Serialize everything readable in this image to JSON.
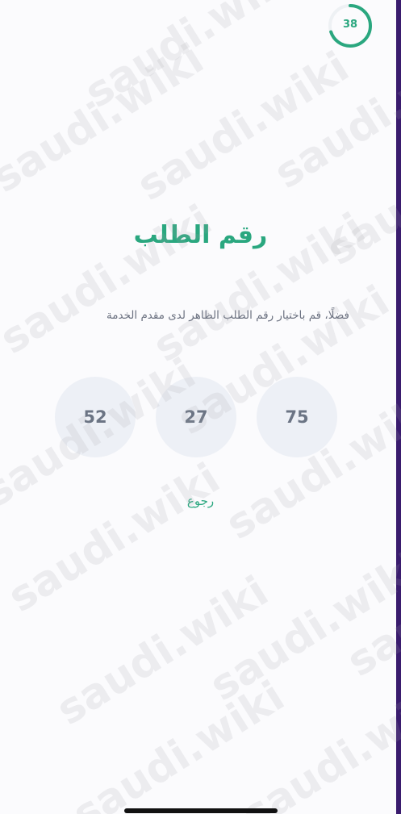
{
  "timer": {
    "seconds": "38",
    "progress": 0.7,
    "color": "#2aa77f"
  },
  "title": "رقم الطلب",
  "subtitle": "فضلًا، قم باختيار رقم الطلب الظاهر لدى مقدم الخدمة",
  "options": [
    "75",
    "27",
    "52"
  ],
  "back_label": "رجوع",
  "watermark": "saudi.wiki",
  "colors": {
    "accent": "#2aa77f",
    "circle_bg": "#edf0f6",
    "number_text": "#6b7484",
    "subtitle_text": "#6b7180"
  }
}
